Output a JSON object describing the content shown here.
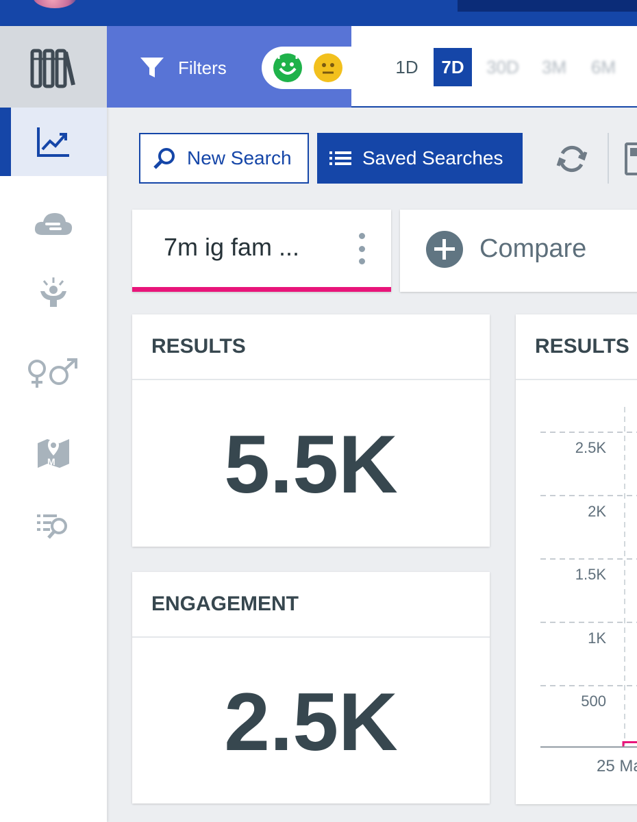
{
  "filters": {
    "label": "Filters",
    "sentiment": [
      "positive",
      "neutral"
    ]
  },
  "periods": [
    "1D",
    "7D",
    "30D",
    "3M",
    "6M"
  ],
  "toolbar": {
    "new_search": "New Search",
    "saved_searches": "Saved Searches"
  },
  "tabs": {
    "active": "7m ig fam ...",
    "compare": "Compare"
  },
  "cards": {
    "results": {
      "title": "RESULTS",
      "value": "5.5K"
    },
    "engagement": {
      "title": "ENGAGEMENT",
      "value": "2.5K"
    },
    "chart": {
      "title": "RESULTS"
    }
  },
  "chart_data": {
    "type": "line",
    "title": "RESULTS",
    "yticks": [
      "2.5K",
      "2K",
      "1.5K",
      "1K",
      "500"
    ],
    "ylim": [
      0,
      2500
    ],
    "x_tick_label": "25 Ma",
    "grid": true,
    "colors": {
      "line": "#e8157a"
    }
  },
  "colors": {
    "primary": "#1546a8",
    "filter_bg": "#5874d6",
    "accent": "#e8157a"
  }
}
